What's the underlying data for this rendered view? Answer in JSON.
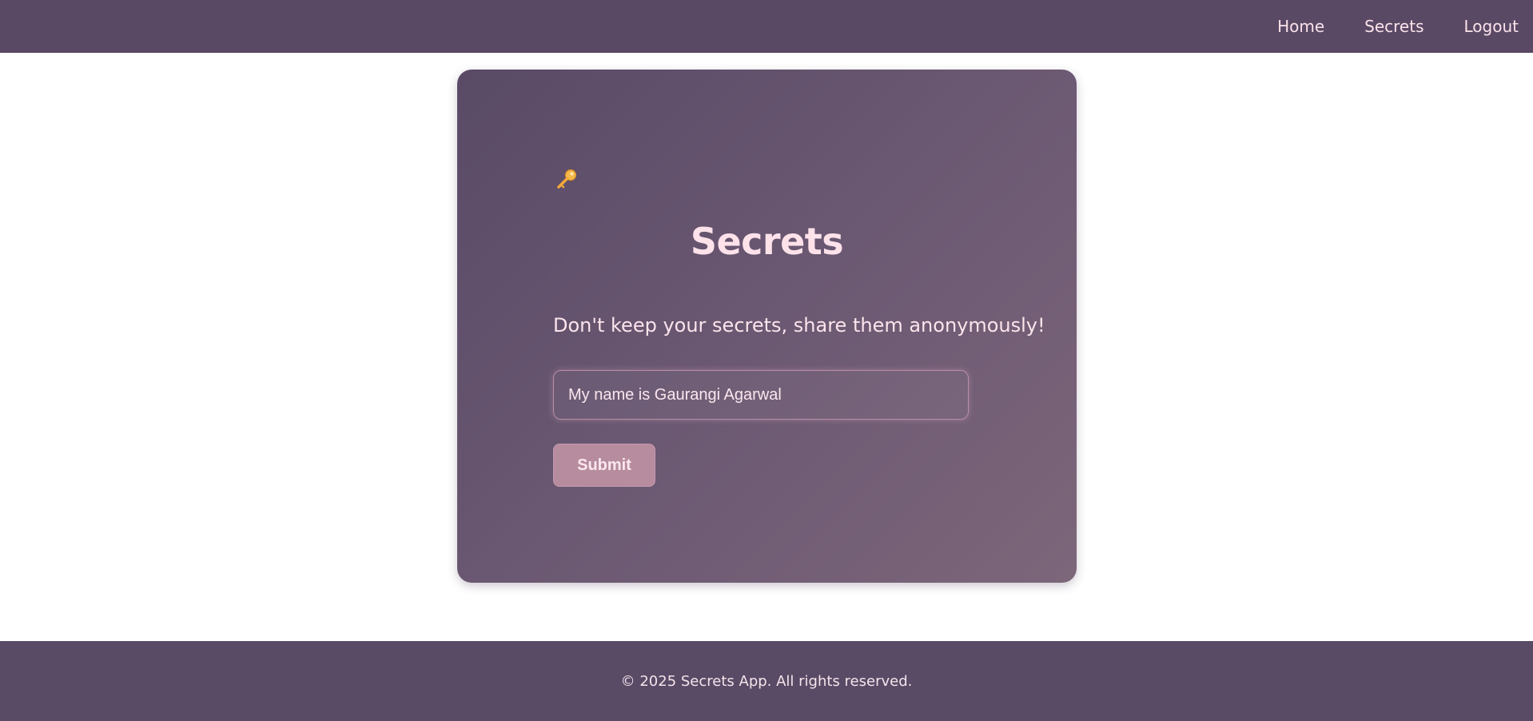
{
  "nav": {
    "items": [
      {
        "label": "Home"
      },
      {
        "label": "Secrets"
      },
      {
        "label": "Logout"
      }
    ]
  },
  "card": {
    "icon": "key-icon",
    "title": "Secrets",
    "tagline": "Don't keep your secrets, share them anonymously!",
    "input_value": "My name is Gaurangi Agarwal",
    "submit_label": "Submit"
  },
  "footer": {
    "text": "© 2025 Secrets App. All rights reserved."
  },
  "colors": {
    "nav_bg": "#5a4965",
    "card_gradient_start": "#594a66",
    "card_gradient_end": "#7c667a",
    "accent_text": "#fde2ea",
    "button_bg": "#b68c9e"
  }
}
